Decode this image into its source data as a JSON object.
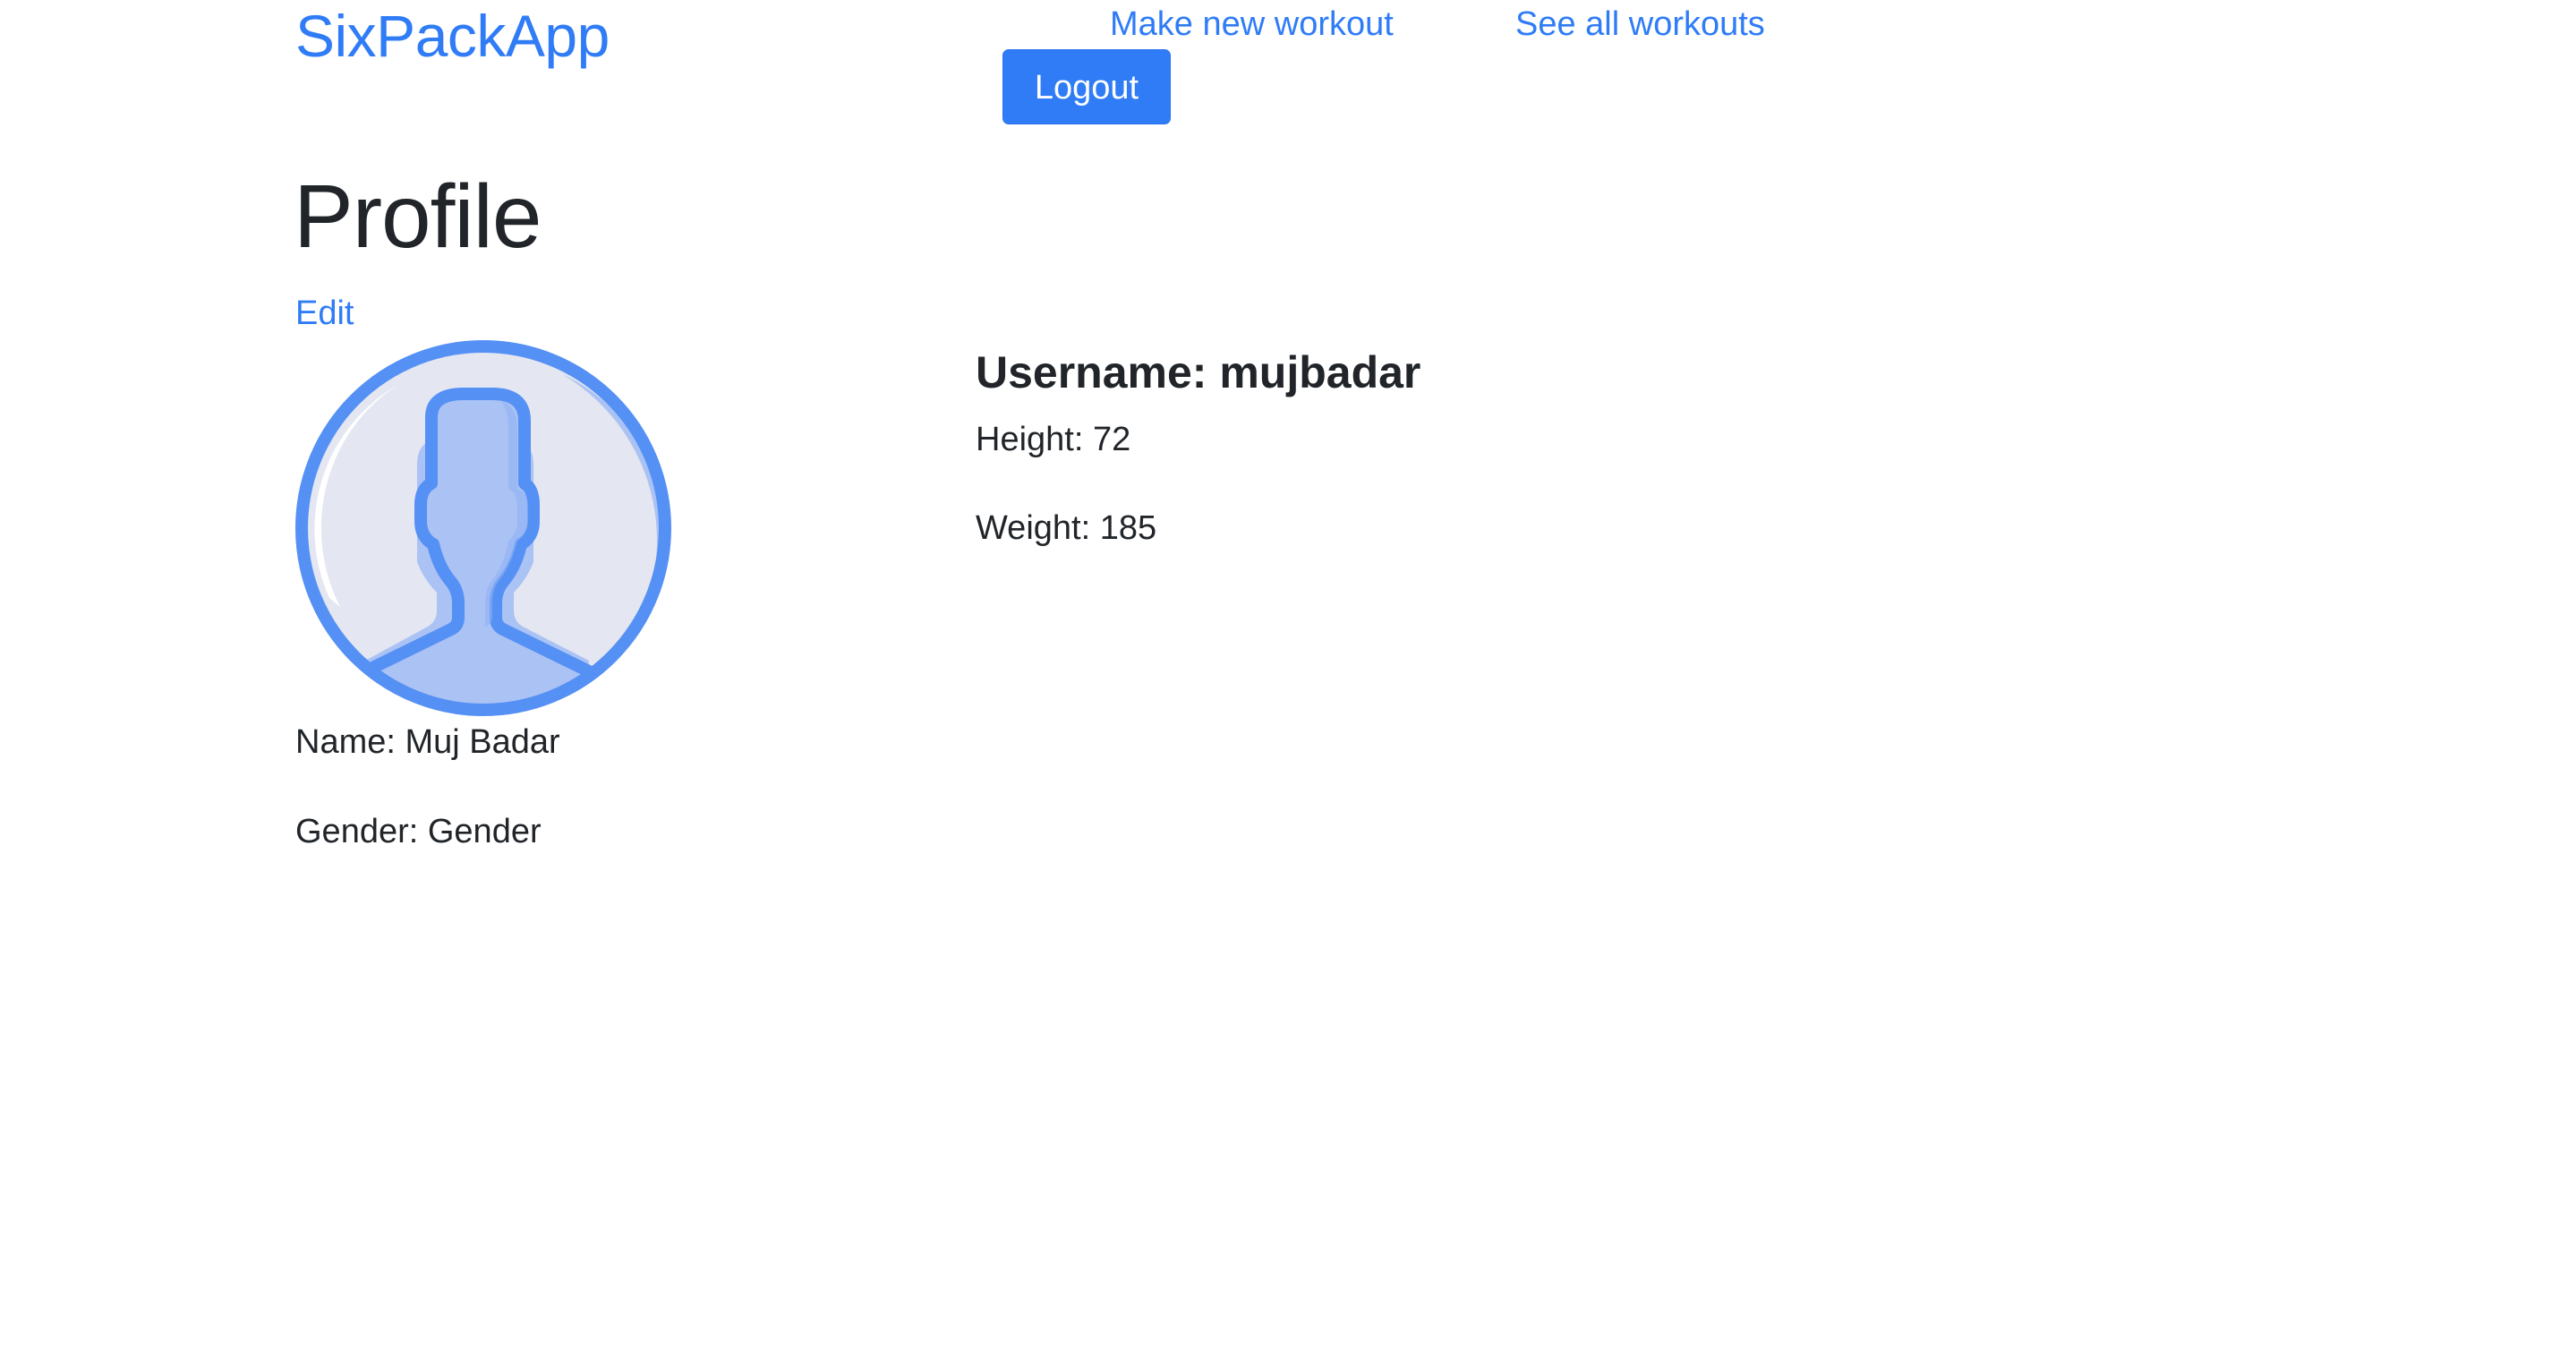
{
  "navbar": {
    "brand": "SixPackApp",
    "links": [
      {
        "label": "Make new workout"
      },
      {
        "label": "See all workouts"
      }
    ],
    "logout_label": "Logout"
  },
  "profile": {
    "title": "Profile",
    "edit_label": "Edit",
    "avatar_icon": "user-silhouette-icon",
    "name": "Name: Muj Badar",
    "gender": "Gender: Gender",
    "username": "Username: mujbadar",
    "height": "Height: 72",
    "weight": "Weight: 185"
  },
  "colors": {
    "link": "#2f7cf6",
    "button_bg": "#2f7cf6",
    "text": "#212529",
    "avatar_bg": "#e4e6f1",
    "avatar_fill": "#aac2f4",
    "avatar_stroke": "#5590f5"
  }
}
